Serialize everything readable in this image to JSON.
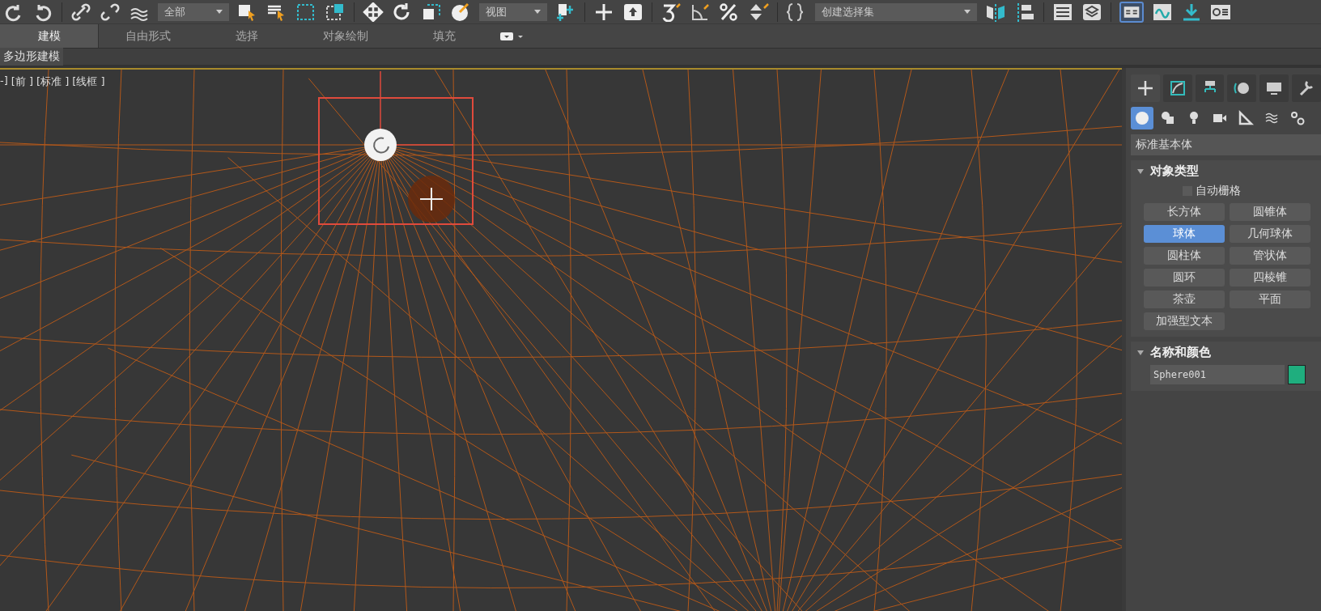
{
  "toolbar": {
    "selection_filter": "全部",
    "reference_coordinate": "视图",
    "named_selection": "创建选择集"
  },
  "ribbon_tabs": [
    {
      "label": "建模",
      "selected": true
    },
    {
      "label": "自由形式",
      "selected": false
    },
    {
      "label": "选择",
      "selected": false
    },
    {
      "label": "对象绘制",
      "selected": false
    },
    {
      "label": "填充",
      "selected": false
    }
  ],
  "ribbon_panel": {
    "label": "多边形建模"
  },
  "viewport": {
    "labels": [
      "-]",
      "[前 ]",
      "[标准 ]",
      "[线框 ]"
    ]
  },
  "command_panel": {
    "tabs": [
      {
        "selected": true
      },
      {
        "selected": false
      },
      {
        "selected": false
      },
      {
        "selected": false
      },
      {
        "selected": false
      },
      {
        "selected": false
      }
    ],
    "categories": [
      {
        "selected": true
      },
      {
        "selected": false
      },
      {
        "selected": false
      },
      {
        "selected": false
      },
      {
        "selected": false
      },
      {
        "selected": false
      },
      {
        "selected": false
      }
    ],
    "dropdown": "标准基本体",
    "object_type": {
      "title": "对象类型",
      "autogrid": {
        "label": "自动栅格",
        "checked": false
      },
      "buttons": [
        {
          "label": "长方体",
          "selected": false
        },
        {
          "label": "圆锥体",
          "selected": false
        },
        {
          "label": "球体",
          "selected": true
        },
        {
          "label": "几何球体",
          "selected": false
        },
        {
          "label": "圆柱体",
          "selected": false
        },
        {
          "label": "管状体",
          "selected": false
        },
        {
          "label": "圆环",
          "selected": false
        },
        {
          "label": "四棱锥",
          "selected": false
        },
        {
          "label": "茶壶",
          "selected": false
        },
        {
          "label": "平面",
          "selected": false
        },
        {
          "label": "加强型文本",
          "selected": false
        }
      ]
    },
    "name_and_color": {
      "title": "名称和颜色",
      "name": "Sphere001",
      "color": "#1fae7e"
    }
  }
}
